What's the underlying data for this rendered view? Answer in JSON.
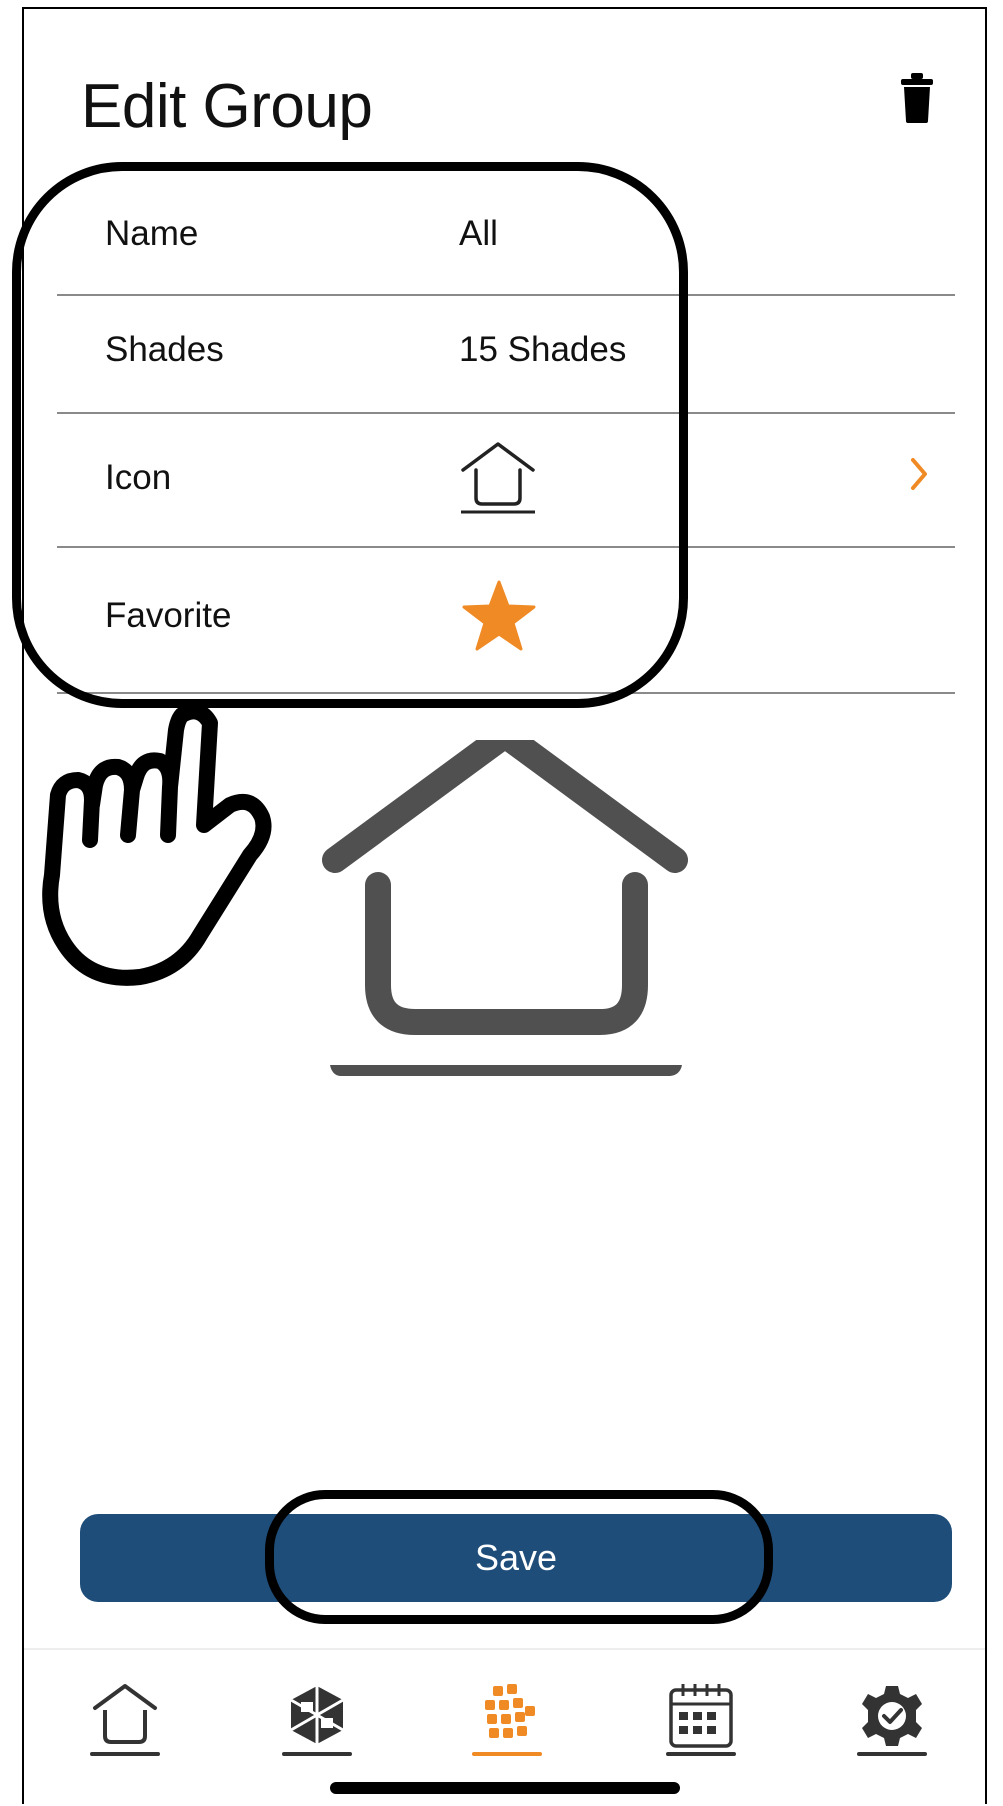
{
  "header": {
    "title": "Edit Group",
    "delete_icon": "trash-icon"
  },
  "rows": [
    {
      "label": "Name",
      "value": "All"
    },
    {
      "label": "Shades",
      "value": "15 Shades"
    },
    {
      "label": "Icon",
      "value_icon": "house-icon",
      "chevron": "chevron-right-icon"
    },
    {
      "label": "Favorite",
      "value_icon": "star-icon"
    }
  ],
  "preview": {
    "icon": "house-icon"
  },
  "footer": {
    "save_label": "Save"
  },
  "tabbar": {
    "tabs": [
      {
        "icon": "home-icon",
        "active": false
      },
      {
        "icon": "cube-icon",
        "active": false
      },
      {
        "icon": "groups-grid-icon",
        "active": true
      },
      {
        "icon": "calendar-icon",
        "active": false
      },
      {
        "icon": "settings-gear-icon",
        "active": false
      }
    ]
  },
  "colors": {
    "accent": "#f08a24",
    "primary": "#1f4d7a",
    "icon_gray": "#505050",
    "divider": "#8a8a8a"
  }
}
